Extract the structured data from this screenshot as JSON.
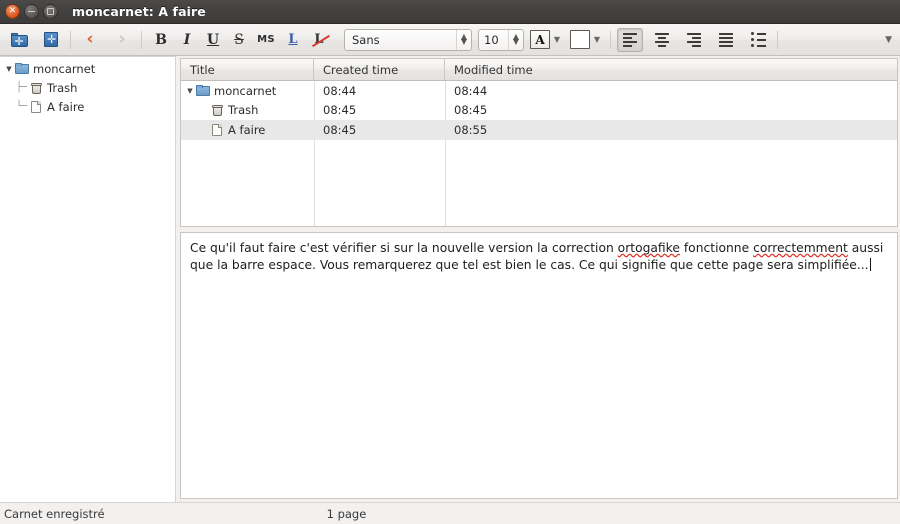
{
  "window": {
    "title": "moncarnet: A faire",
    "controls": {
      "close": "close-button",
      "minimize": "minimize-button",
      "maximize": "maximize-button"
    }
  },
  "toolbar": {
    "new_folder": "new-folder-icon",
    "new_page": "new-page-icon",
    "back": "‹",
    "forward": "›",
    "bold": "B",
    "italic": "I",
    "underline": "U",
    "strike": "S",
    "monospace": "MS",
    "link": "L",
    "unlink": "L",
    "font_name": "Sans",
    "font_size": "10",
    "text_color": "A",
    "spin_up": "▲",
    "spin_down": "▼",
    "caret": "▼",
    "overflow": "▼"
  },
  "sidebar": {
    "items": [
      {
        "label": "moncarnet",
        "icon": "folder-icon",
        "expander": "▼",
        "depth": 0
      },
      {
        "label": "Trash",
        "icon": "trash-icon",
        "expander": "",
        "depth": 1
      },
      {
        "label": "A faire",
        "icon": "page-icon",
        "expander": "",
        "depth": 1
      }
    ]
  },
  "index_table": {
    "columns": [
      "Title",
      "Created time",
      "Modified time"
    ],
    "rows": [
      {
        "title": "moncarnet",
        "created": "08:44",
        "modified": "08:44",
        "icon": "folder-icon",
        "expander": "▼",
        "depth": 0,
        "selected": false
      },
      {
        "title": "Trash",
        "created": "08:45",
        "modified": "08:45",
        "icon": "trash-icon",
        "expander": "",
        "depth": 1,
        "selected": false
      },
      {
        "title": "A faire",
        "created": "08:45",
        "modified": "08:55",
        "icon": "page-icon",
        "expander": "",
        "depth": 1,
        "selected": true
      }
    ]
  },
  "editor": {
    "text_part1": "Ce qu'il faut faire c'est vérifier si sur la nouvelle version la correction ",
    "misspelled1": "ortogafike",
    "text_part2": " fonctionne ",
    "misspelled2": "correctemment",
    "text_part3": " aussi que la barre espace. Vous remarquerez que tel est bien le cas. Ce qui signifie que cette page sera simplifiée..."
  },
  "status": {
    "message": "Carnet enregistré",
    "pages": "1 page"
  },
  "colors": {
    "titlebar": "#434140",
    "close_button": "#e2602a",
    "accent_blue": "#2f6aa8",
    "back_arrow": "#e2622a",
    "spellcheck_underline": "#e2372b",
    "selection": "#e8e8e8"
  }
}
